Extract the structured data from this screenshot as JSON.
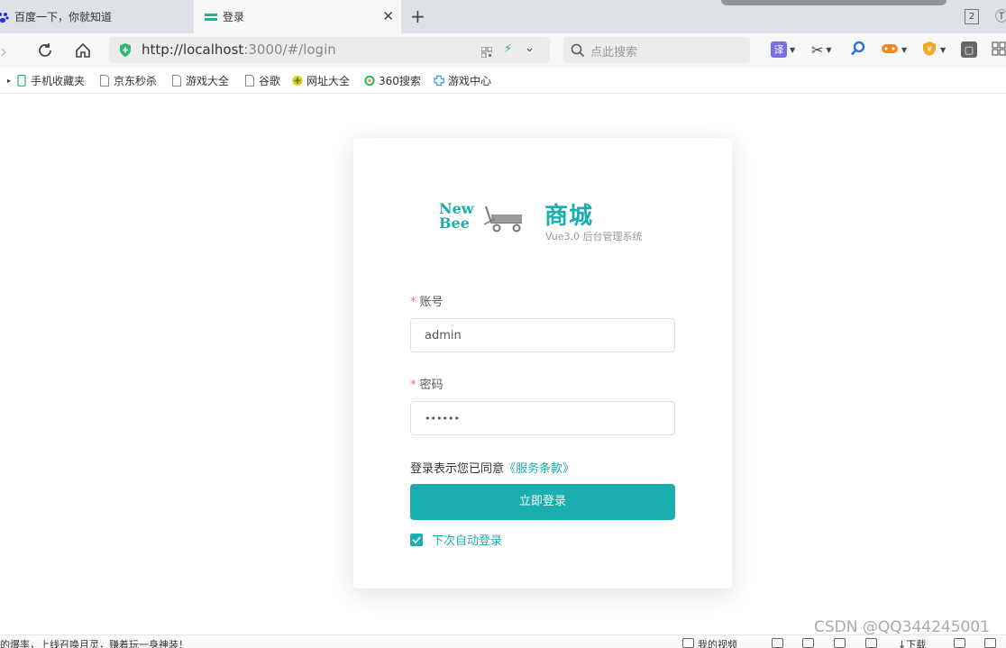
{
  "browser": {
    "tabs": [
      {
        "label": "百度一下，你就知道",
        "active": false
      },
      {
        "label": "登录",
        "active": true
      }
    ],
    "tab_count": "2",
    "url": {
      "host": "http://localhost",
      "rest": ":3000/#/login"
    },
    "search_placeholder": "点此搜索",
    "bookmarks": [
      "手机收藏夹",
      "京东秒杀",
      "游戏大全",
      "谷歌",
      "网址大全",
      "360搜索",
      "游戏中心"
    ]
  },
  "login": {
    "brand": {
      "logo_line1": "New",
      "logo_line2": "Bee",
      "title": "商城",
      "subtitle": "Vue3.0 后台管理系统"
    },
    "account_label": "账号",
    "account_value": "admin",
    "password_label": "密码",
    "password_value": "••••••",
    "agreement_text": "登录表示您已同意",
    "agreement_link": "《服务条款》",
    "submit_label": "立即登录",
    "remember_label": "下次自动登录",
    "remember_checked": true,
    "accent_color": "#1baeae"
  },
  "statusbar": {
    "news": "的爆率，上线召唤月灵，赚着玩一身神装！",
    "items": [
      "我的视频",
      "下载"
    ]
  },
  "watermark": "CSDN @QQ344245001"
}
